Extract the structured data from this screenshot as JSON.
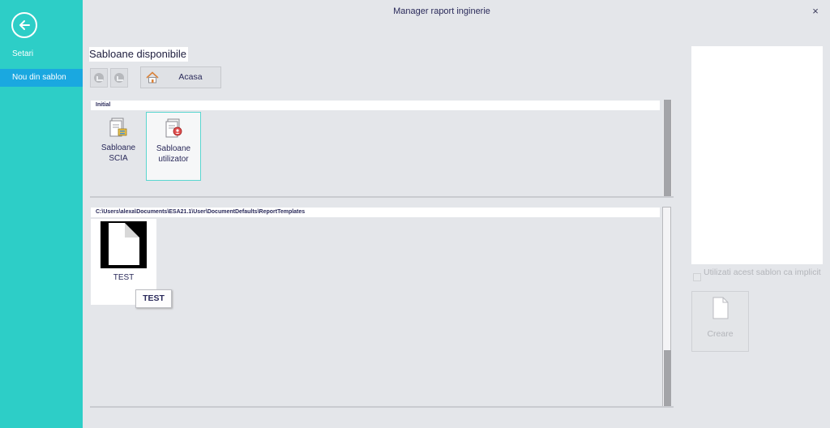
{
  "window": {
    "title": "Manager raport inginerie",
    "close_glyph": "×"
  },
  "sidebar": {
    "back_icon": "arrow-left-icon",
    "items": [
      {
        "label": "Setari",
        "active": false
      },
      {
        "label": "Nou din sablon",
        "active": true
      }
    ]
  },
  "main": {
    "heading": "Sabloane disponibile",
    "toolbar": {
      "home_label": "Acasa"
    },
    "panels": [
      {
        "header": "Initial",
        "tiles": [
          {
            "label": "Sabloane SCIA",
            "icon": "template-document-icon"
          },
          {
            "label": "Sabloane utilizator",
            "icon": "user-template-icon",
            "selected": true
          }
        ]
      },
      {
        "header": "C:\\Users\\alexa\\Documents\\ESA21.1\\User\\DocumentDefaults\\ReportTemplates",
        "tiles": [
          {
            "label": "TEST",
            "icon": "blank-document-icon"
          }
        ],
        "tooltip": "TEST"
      }
    ]
  },
  "right_panel": {
    "default_checkbox_label": "Utilizati acest sablon ca implicit",
    "default_checked": false,
    "create_label": "Creare"
  },
  "colors": {
    "sidebar": "#2dcec7",
    "sidebar_active": "#1aa8e0",
    "background": "#e4e6ea",
    "text": "#2a2a5a"
  }
}
